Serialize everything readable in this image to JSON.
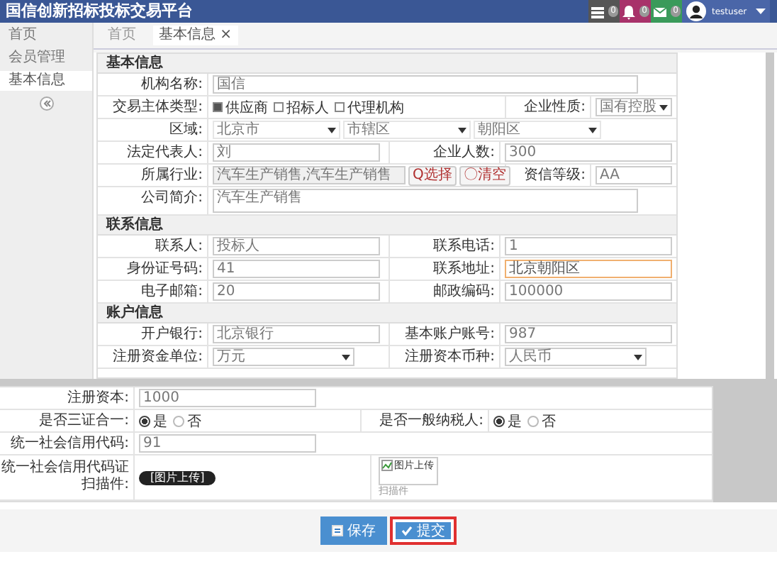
{
  "header": {
    "title": "国信创新招标投标交易平台",
    "notifications": [
      {
        "kind": "tasks",
        "count": "0",
        "color": "#555555"
      },
      {
        "kind": "bell",
        "count": "0",
        "color": "#a8326a"
      },
      {
        "kind": "mail",
        "count": "0",
        "color": "#3a9a5a"
      }
    ],
    "user": "testuser"
  },
  "sidebar": {
    "items": [
      {
        "label": "首页",
        "selected": false
      },
      {
        "label": "会员管理",
        "selected": false
      },
      {
        "label": "基本信息",
        "selected": true
      }
    ]
  },
  "breadcrumb_tabs": [
    {
      "label": "首页",
      "selected": false
    },
    {
      "label": "基本信息 ×",
      "selected": true
    }
  ],
  "sections": [
    {
      "title": "基本信息",
      "rows": [
        [
          {
            "label": "机构名称:",
            "kind": "text",
            "value": "国信"
          }
        ],
        [
          {
            "label": "交易主体类型:",
            "kind": "checks",
            "options": [
              {
                "label": "供应商",
                "checked": true
              },
              {
                "label": "招标人",
                "checked": false
              },
              {
                "label": "代理机构",
                "checked": false
              }
            ]
          },
          {
            "label": "企业性质:",
            "kind": "select",
            "value": "国有控股"
          }
        ],
        [
          {
            "label": "区域:",
            "kind": "region",
            "selects": [
              "北京市",
              "市辖区",
              "朝阳区"
            ]
          }
        ],
        [
          {
            "label": "法定代表人:",
            "kind": "text",
            "value": "刘"
          },
          {
            "label": "企业人数:",
            "kind": "text",
            "value": "300"
          }
        ],
        [
          {
            "label": "所属行业:",
            "kind": "industry",
            "value": "汽车生产销售,汽车生产销售",
            "buttons": [
              "Q选择",
              "〇清空"
            ]
          },
          {
            "label": "资信等级:",
            "kind": "text",
            "value": "AA"
          }
        ],
        [
          {
            "label": "公司简介:",
            "kind": "textarea",
            "value": "汽车生产销售"
          }
        ]
      ]
    },
    {
      "title": "联系信息",
      "rows": [
        [
          {
            "label": "联系人:",
            "kind": "text",
            "value": "投标人"
          },
          {
            "label": "联系电话:",
            "kind": "text",
            "value": "1"
          }
        ],
        [
          {
            "label": "身份证号码:",
            "kind": "text",
            "value": "41"
          },
          {
            "label": "联系地址:",
            "kind": "text",
            "value": "北京朝阳区",
            "focused": true
          }
        ],
        [
          {
            "label": "电子邮箱:",
            "kind": "text",
            "value": "20"
          },
          {
            "label": "邮政编码:",
            "kind": "text",
            "value": "100000"
          }
        ]
      ]
    },
    {
      "title": "账户信息",
      "rows": [
        [
          {
            "label": "开户银行:",
            "kind": "text",
            "value": "北京银行"
          },
          {
            "label": "基本账户账号:",
            "kind": "text",
            "value": "987"
          }
        ],
        [
          {
            "label": "注册资金单位:",
            "kind": "select",
            "value": "万元"
          },
          {
            "label": "注册资本币种:",
            "kind": "select",
            "value": "人民币"
          }
        ]
      ]
    }
  ],
  "lower_form": {
    "rows": [
      [
        {
          "label": "注册资本:",
          "kind": "text",
          "value": "1000"
        }
      ],
      [
        {
          "label": "是否三证合一:",
          "kind": "radios",
          "options": [
            {
              "label": "是",
              "selected": true
            },
            {
              "label": "否",
              "selected": false
            }
          ]
        },
        {
          "label": "是否一般纳税人:",
          "kind": "radios",
          "options": [
            {
              "label": "是",
              "selected": true
            },
            {
              "label": "否",
              "selected": false
            }
          ]
        }
      ],
      [
        {
          "label": "统一社会信用代码:",
          "kind": "text",
          "value": "91"
        }
      ],
      [
        {
          "label": "统一社会信用代码证扫描件:",
          "kind": "upload",
          "button": "[图片上传]",
          "image_alt": "图片上传",
          "caption": "扫描件"
        }
      ]
    ]
  },
  "actions": [
    {
      "label": "保存",
      "kind": "save",
      "highlighted": false
    },
    {
      "label": "提交",
      "kind": "submit",
      "highlighted": true
    }
  ]
}
